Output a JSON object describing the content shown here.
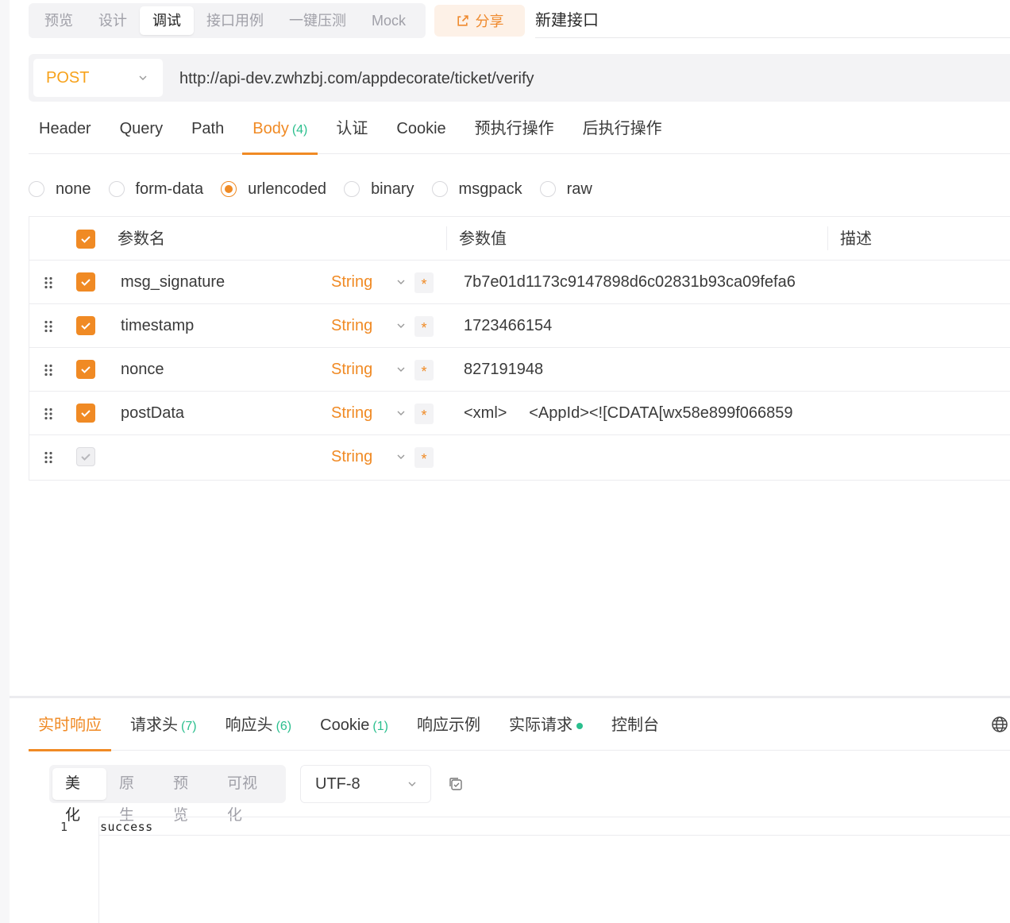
{
  "modes": [
    "预览",
    "设计",
    "调试",
    "接口用例",
    "一键压测",
    "Mock"
  ],
  "active_mode": "调试",
  "share_label": "分享",
  "api_name": "新建接口",
  "method": "POST",
  "url": "http://api-dev.zwhzbj.com/appdecorate/ticket/verify",
  "request_tabs": [
    {
      "label": "Header",
      "count": ""
    },
    {
      "label": "Query",
      "count": ""
    },
    {
      "label": "Path",
      "count": ""
    },
    {
      "label": "Body",
      "count": "(4)"
    },
    {
      "label": "认证",
      "count": ""
    },
    {
      "label": "Cookie",
      "count": ""
    },
    {
      "label": "预执行操作",
      "count": ""
    },
    {
      "label": "后执行操作",
      "count": ""
    }
  ],
  "body_types": [
    "none",
    "form-data",
    "urlencoded",
    "binary",
    "msgpack",
    "raw"
  ],
  "selected_body_type": "urlencoded",
  "table": {
    "headers": {
      "name": "参数名",
      "value": "参数值",
      "desc": "描述"
    },
    "rows": [
      {
        "name": "msg_signature",
        "type": "String",
        "required": "*",
        "value": "7b7e01d1173c9147898d6c02831b93ca09fefa6",
        "checked": true
      },
      {
        "name": "timestamp",
        "type": "String",
        "required": "*",
        "value": "1723466154",
        "checked": true
      },
      {
        "name": "nonce",
        "type": "String",
        "required": "*",
        "value": "827191948",
        "checked": true
      },
      {
        "name": "postData",
        "type": "String",
        "required": "*",
        "value": "<xml>     <AppId><![CDATA[wx58e899f066859",
        "checked": true
      },
      {
        "name": "",
        "type": "String",
        "required": "*",
        "value": "",
        "checked": false
      }
    ]
  },
  "response_tabs": [
    {
      "label": "实时响应",
      "count": ""
    },
    {
      "label": "请求头",
      "count": "(7)"
    },
    {
      "label": "响应头",
      "count": "(6)"
    },
    {
      "label": "Cookie",
      "count": "(1)"
    },
    {
      "label": "响应示例",
      "count": ""
    },
    {
      "label": "实际请求",
      "count": ""
    },
    {
      "label": "控制台",
      "count": ""
    }
  ],
  "format_buttons": [
    "美化",
    "原生",
    "预览",
    "可视化"
  ],
  "encoding": "UTF-8",
  "response_lines": [
    {
      "num": "1",
      "text": "success"
    }
  ],
  "colors": {
    "accent": "#f08a24",
    "method": "#f7a21b",
    "count": "#2bbf8e"
  }
}
